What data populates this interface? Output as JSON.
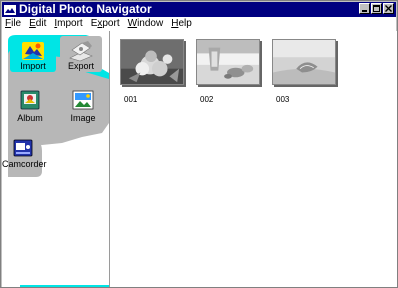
{
  "window": {
    "title": "Digital Photo Navigator",
    "title_bar_color": "#000080"
  },
  "menu": {
    "items": [
      {
        "label": "File",
        "accel": "F",
        "rest": "ile"
      },
      {
        "label": "Edit",
        "accel": "E",
        "rest": "dit"
      },
      {
        "label": "Import",
        "accel": "I",
        "rest": "mport"
      },
      {
        "label": "Export",
        "accel": "x",
        "pre": "E",
        "rest": "port"
      },
      {
        "label": "Window",
        "accel": "W",
        "rest": "indow"
      },
      {
        "label": "Help",
        "accel": "H",
        "rest": "elp"
      }
    ]
  },
  "sidebar": {
    "accent_color": "#00e5e5",
    "items": [
      {
        "label": "Import",
        "icon": "import-icon"
      },
      {
        "label": "Export",
        "icon": "export-icon"
      },
      {
        "label": "Album",
        "icon": "album-icon"
      },
      {
        "label": "Image",
        "icon": "image-icon"
      },
      {
        "label": "Camcorder",
        "icon": "camcorder-icon"
      }
    ]
  },
  "thumbnails": [
    {
      "caption": "001"
    },
    {
      "caption": "002"
    },
    {
      "caption": "003"
    }
  ]
}
